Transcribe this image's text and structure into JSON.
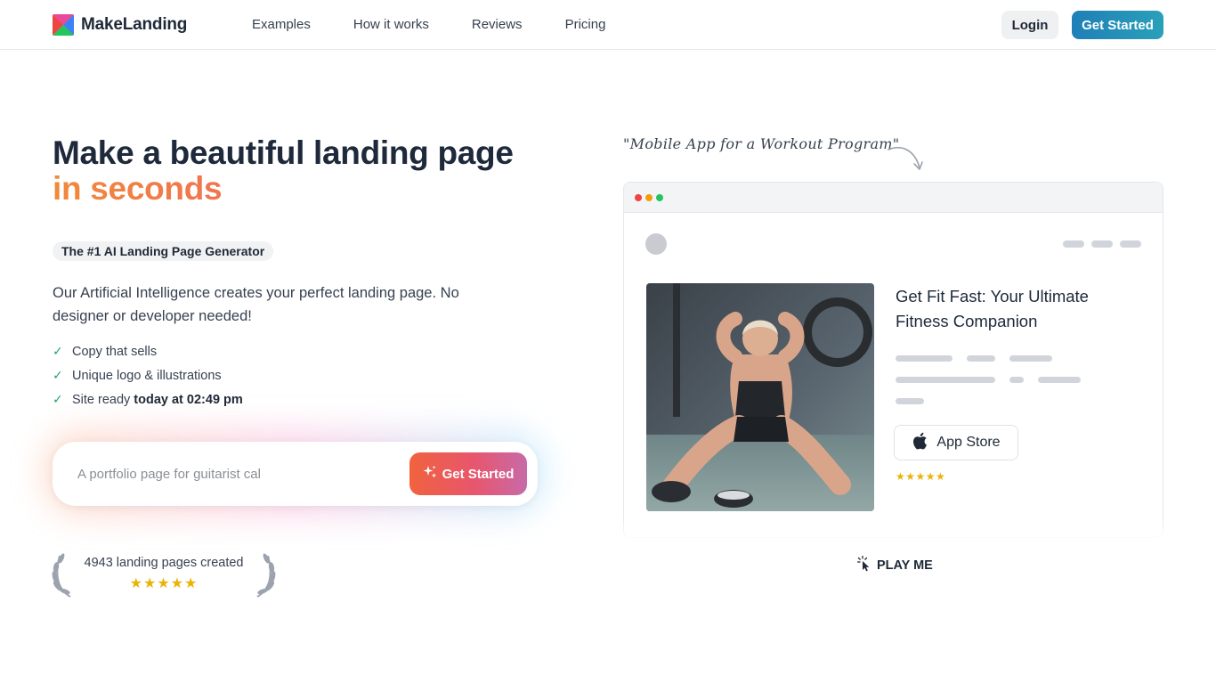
{
  "brand": {
    "name": "MakeLanding"
  },
  "nav": {
    "items": [
      "Examples",
      "How it works",
      "Reviews",
      "Pricing"
    ]
  },
  "header": {
    "login_label": "Login",
    "get_started_label": "Get Started"
  },
  "hero": {
    "title_line1": "Make a beautiful landing page",
    "title_line2": "in seconds",
    "badge": "The #1 AI Landing Page Generator",
    "description": "Our Artificial Intelligence creates your perfect landing page. No designer or developer needed!",
    "features": [
      {
        "text": "Copy that sells",
        "bold": ""
      },
      {
        "text": "Unique logo & illustrations",
        "bold": ""
      },
      {
        "text": "Site ready",
        "bold": "today at 02:49 pm"
      }
    ],
    "prompt_placeholder": "A portfolio page for guitarist cal",
    "prompt_button": "Get Started",
    "counter_text": "4943 landing pages created",
    "counter_stars": "★★★★★"
  },
  "preview": {
    "handnote": "\"Mobile App for a Workout Program\"",
    "mock_title": "Get Fit Fast: Your Ultimate Fitness Companion",
    "app_store_label": "App Store",
    "mock_stars": "★★★★★",
    "play_label": "PLAY ME"
  },
  "colors": {
    "accent_gradient_start": "#f08a3c",
    "accent_gradient_end": "#ef4f73",
    "header_button": "#1f7fb8",
    "check": "#22a36b",
    "stars": "#eab308"
  }
}
